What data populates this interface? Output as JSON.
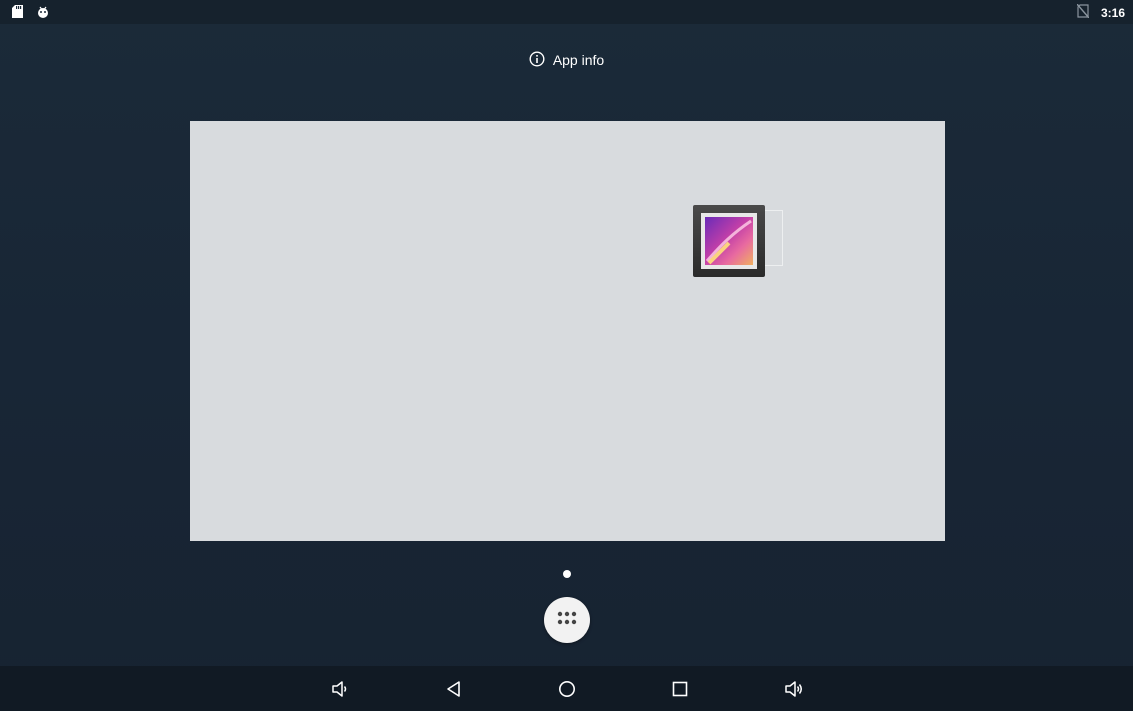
{
  "status_bar": {
    "left_icons": [
      "sd-card-icon",
      "android-debug-icon"
    ],
    "right_icons": [
      "no-sim-icon"
    ],
    "time": "3:16"
  },
  "drop_target": {
    "label": "App info",
    "icon": "info-icon"
  },
  "workspace": {
    "apps": [
      {
        "icon": "gallery-icon",
        "label": ""
      }
    ]
  },
  "page_indicator": {
    "pages": 1,
    "current": 1
  },
  "all_apps": {
    "icon": "all-apps-icon"
  },
  "nav_bar": {
    "buttons": [
      "volume-down-icon",
      "back-icon",
      "home-icon",
      "recents-icon",
      "volume-up-icon"
    ]
  },
  "colors": {
    "background": "#1a2836",
    "workspace_bg": "#d8dbde",
    "nav_bg": "#111a24"
  }
}
